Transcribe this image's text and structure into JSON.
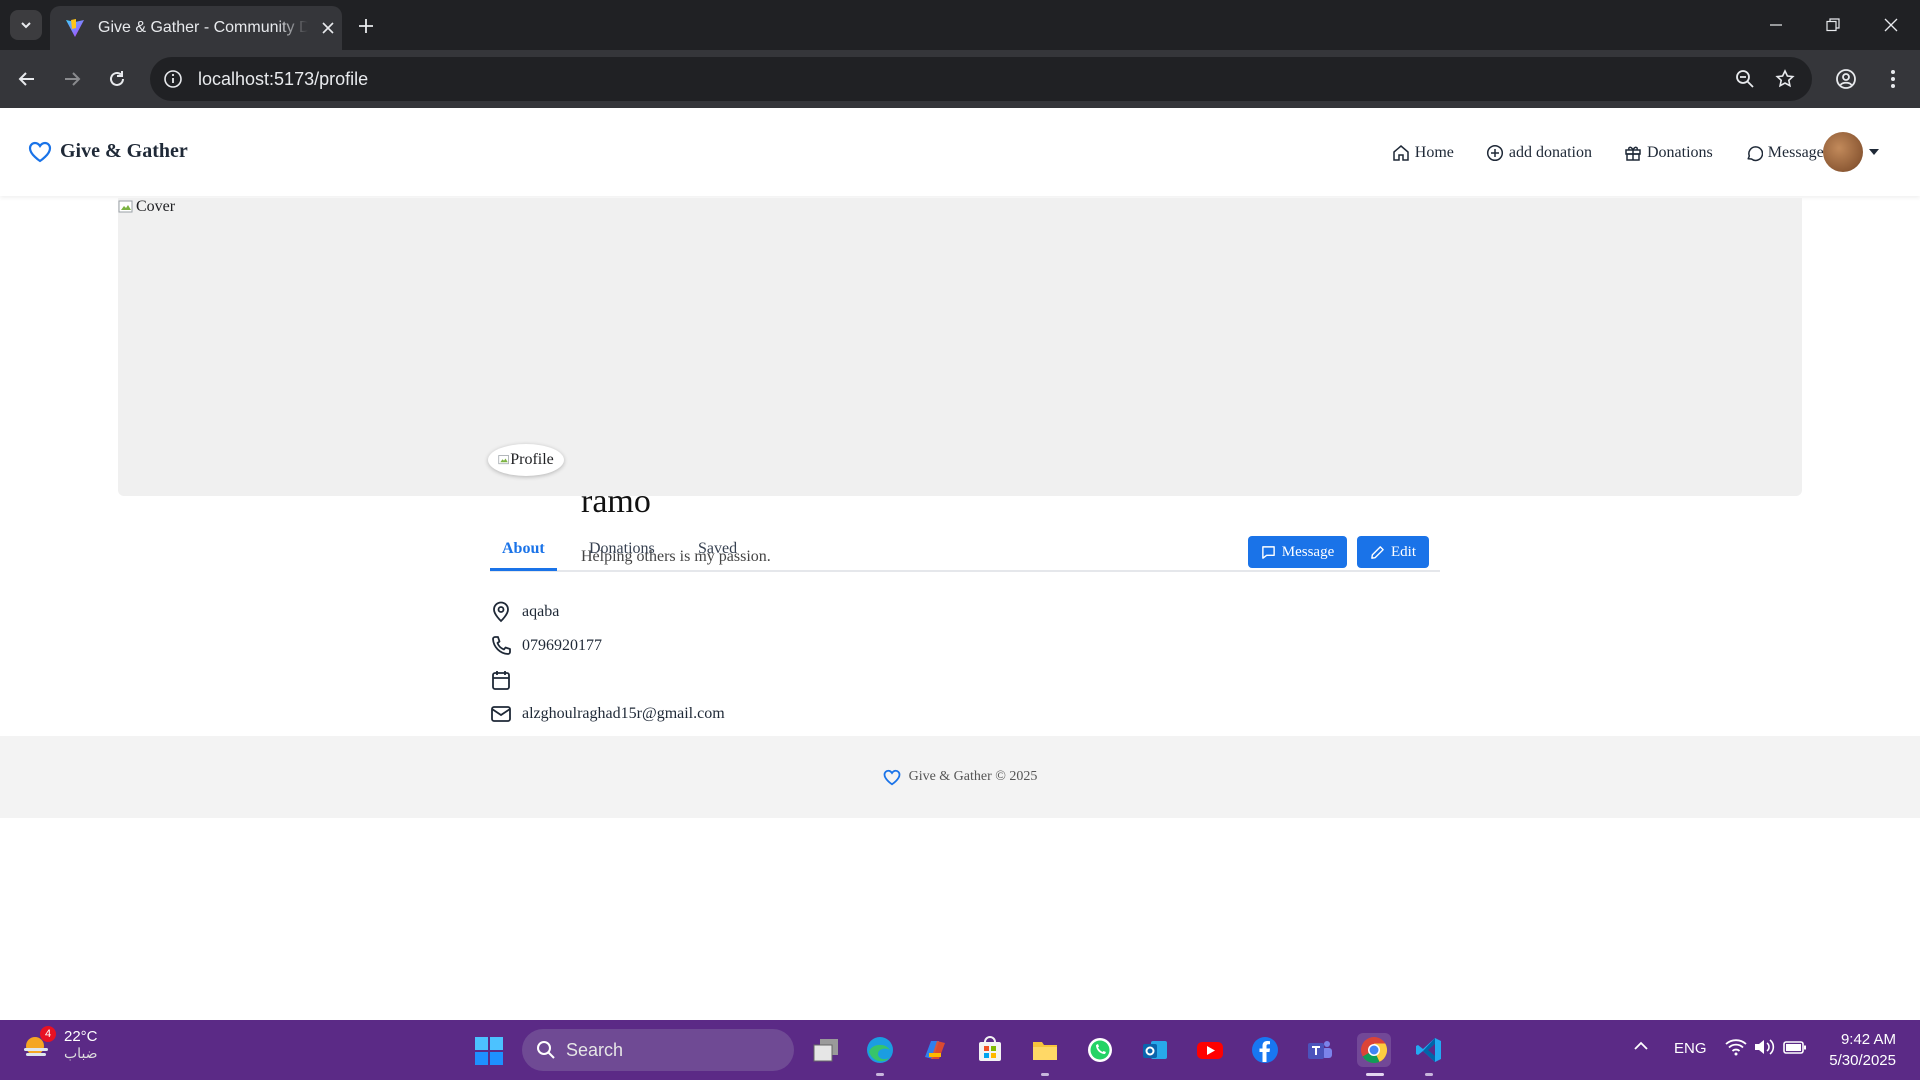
{
  "browser": {
    "tab_title": "Give & Gather - Community Do",
    "url": "localhost:5173/profile"
  },
  "site": {
    "brand": "Give & Gather",
    "nav": {
      "home": "Home",
      "add_donation": "add donation",
      "donations": "Donations",
      "messages": "Messages"
    },
    "cover_alt": "Cover",
    "profile_alt": "Profile",
    "profile": {
      "name": "ramo",
      "bio": "Helping others is my passion."
    },
    "tabs": [
      "About",
      "Donations",
      "Saved"
    ],
    "active_tab": "About",
    "buttons": {
      "message": "Message",
      "edit": "Edit"
    },
    "about": {
      "location": "aqaba",
      "phone": "0796920177",
      "date": "",
      "email": "alzghoulraghad15r@gmail.com"
    },
    "footer": "Give & Gather © 2025",
    "accent_color": "#1a73e8"
  },
  "taskbar": {
    "weather_temp": "22°C",
    "weather_desc": "ضباب",
    "weather_badge": "4",
    "search_label": "Search",
    "language": "ENG",
    "time": "9:42 AM",
    "date": "5/30/2025"
  }
}
